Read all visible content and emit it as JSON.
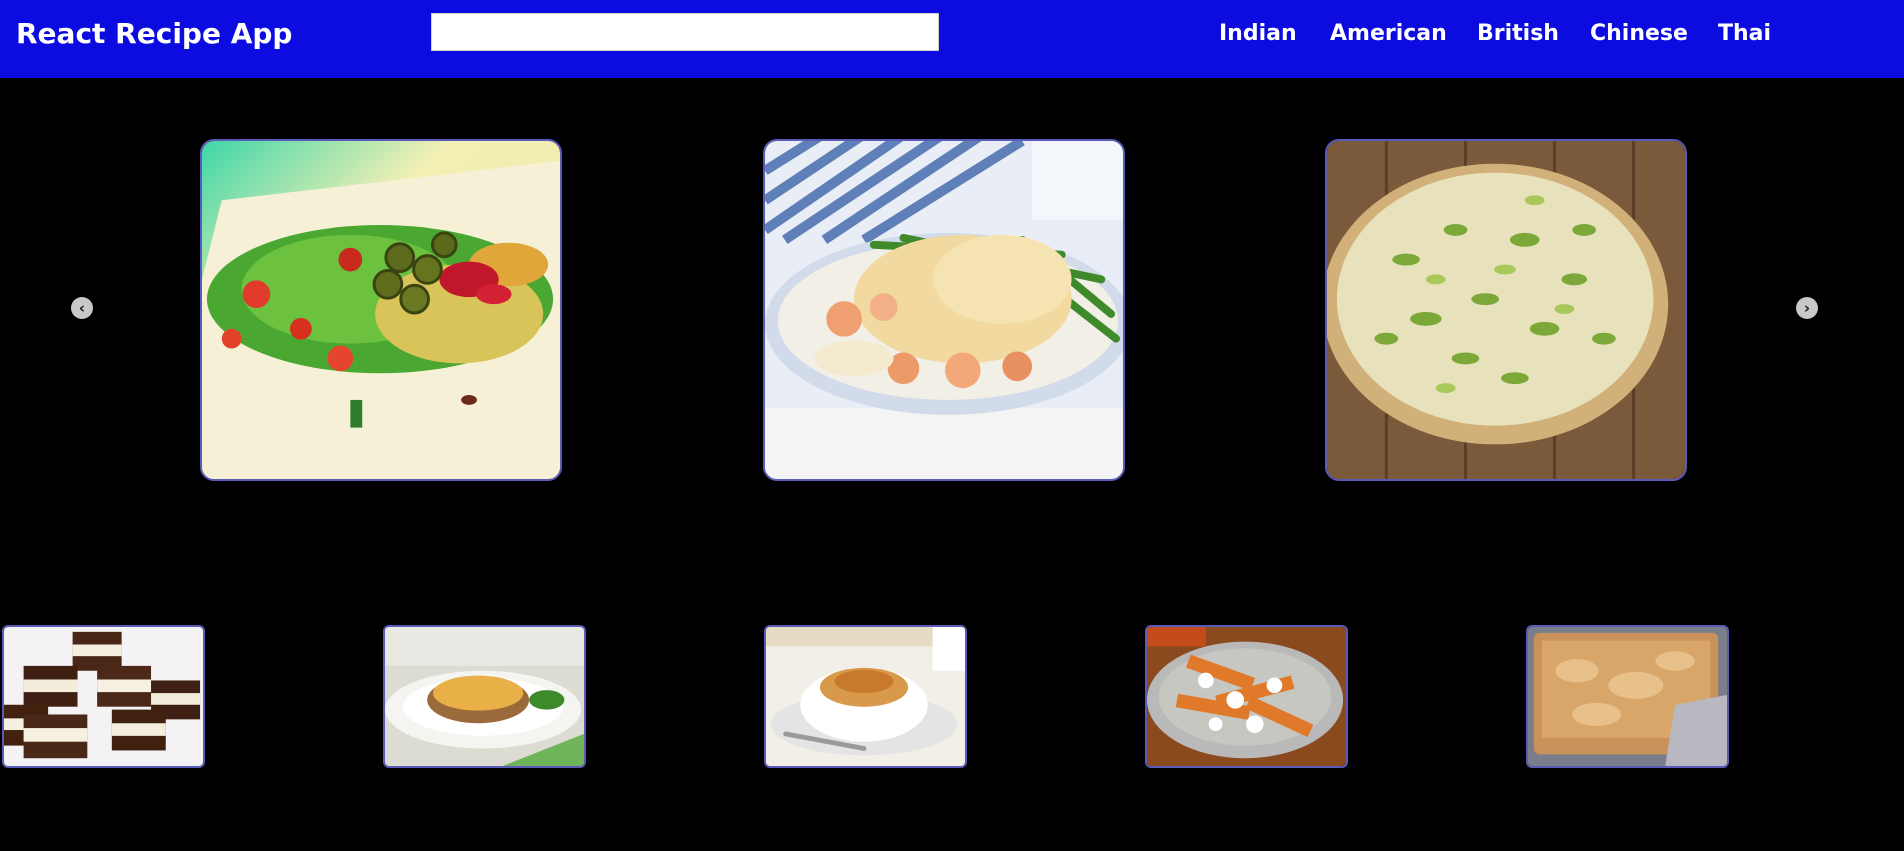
{
  "header": {
    "brand": "React Recipe App",
    "search_value": "",
    "cuisines": [
      "Indian",
      "American",
      "British",
      "Chinese",
      "Thai"
    ]
  },
  "carousel": {
    "prev_icon": "chevron-left-circle-icon",
    "next_icon": "chevron-right-circle-icon",
    "prev_glyph": "‹",
    "next_glyph": "›",
    "featured": [
      {
        "dish": "salad-nachos-image"
      },
      {
        "dish": "fish-pie-image"
      },
      {
        "dish": "leek-quiche-image"
      }
    ]
  },
  "grid": {
    "items": [
      {
        "dish": "chocolate-bars-image"
      },
      {
        "dish": "shepherds-pie-image"
      },
      {
        "dish": "pudding-bowl-image"
      },
      {
        "dish": "poutine-plate-image"
      },
      {
        "dish": "baked-tray-image"
      }
    ]
  },
  "colors": {
    "navbar": "#0c0ce0",
    "background": "#000000",
    "card_border": "#5a5ab8"
  }
}
